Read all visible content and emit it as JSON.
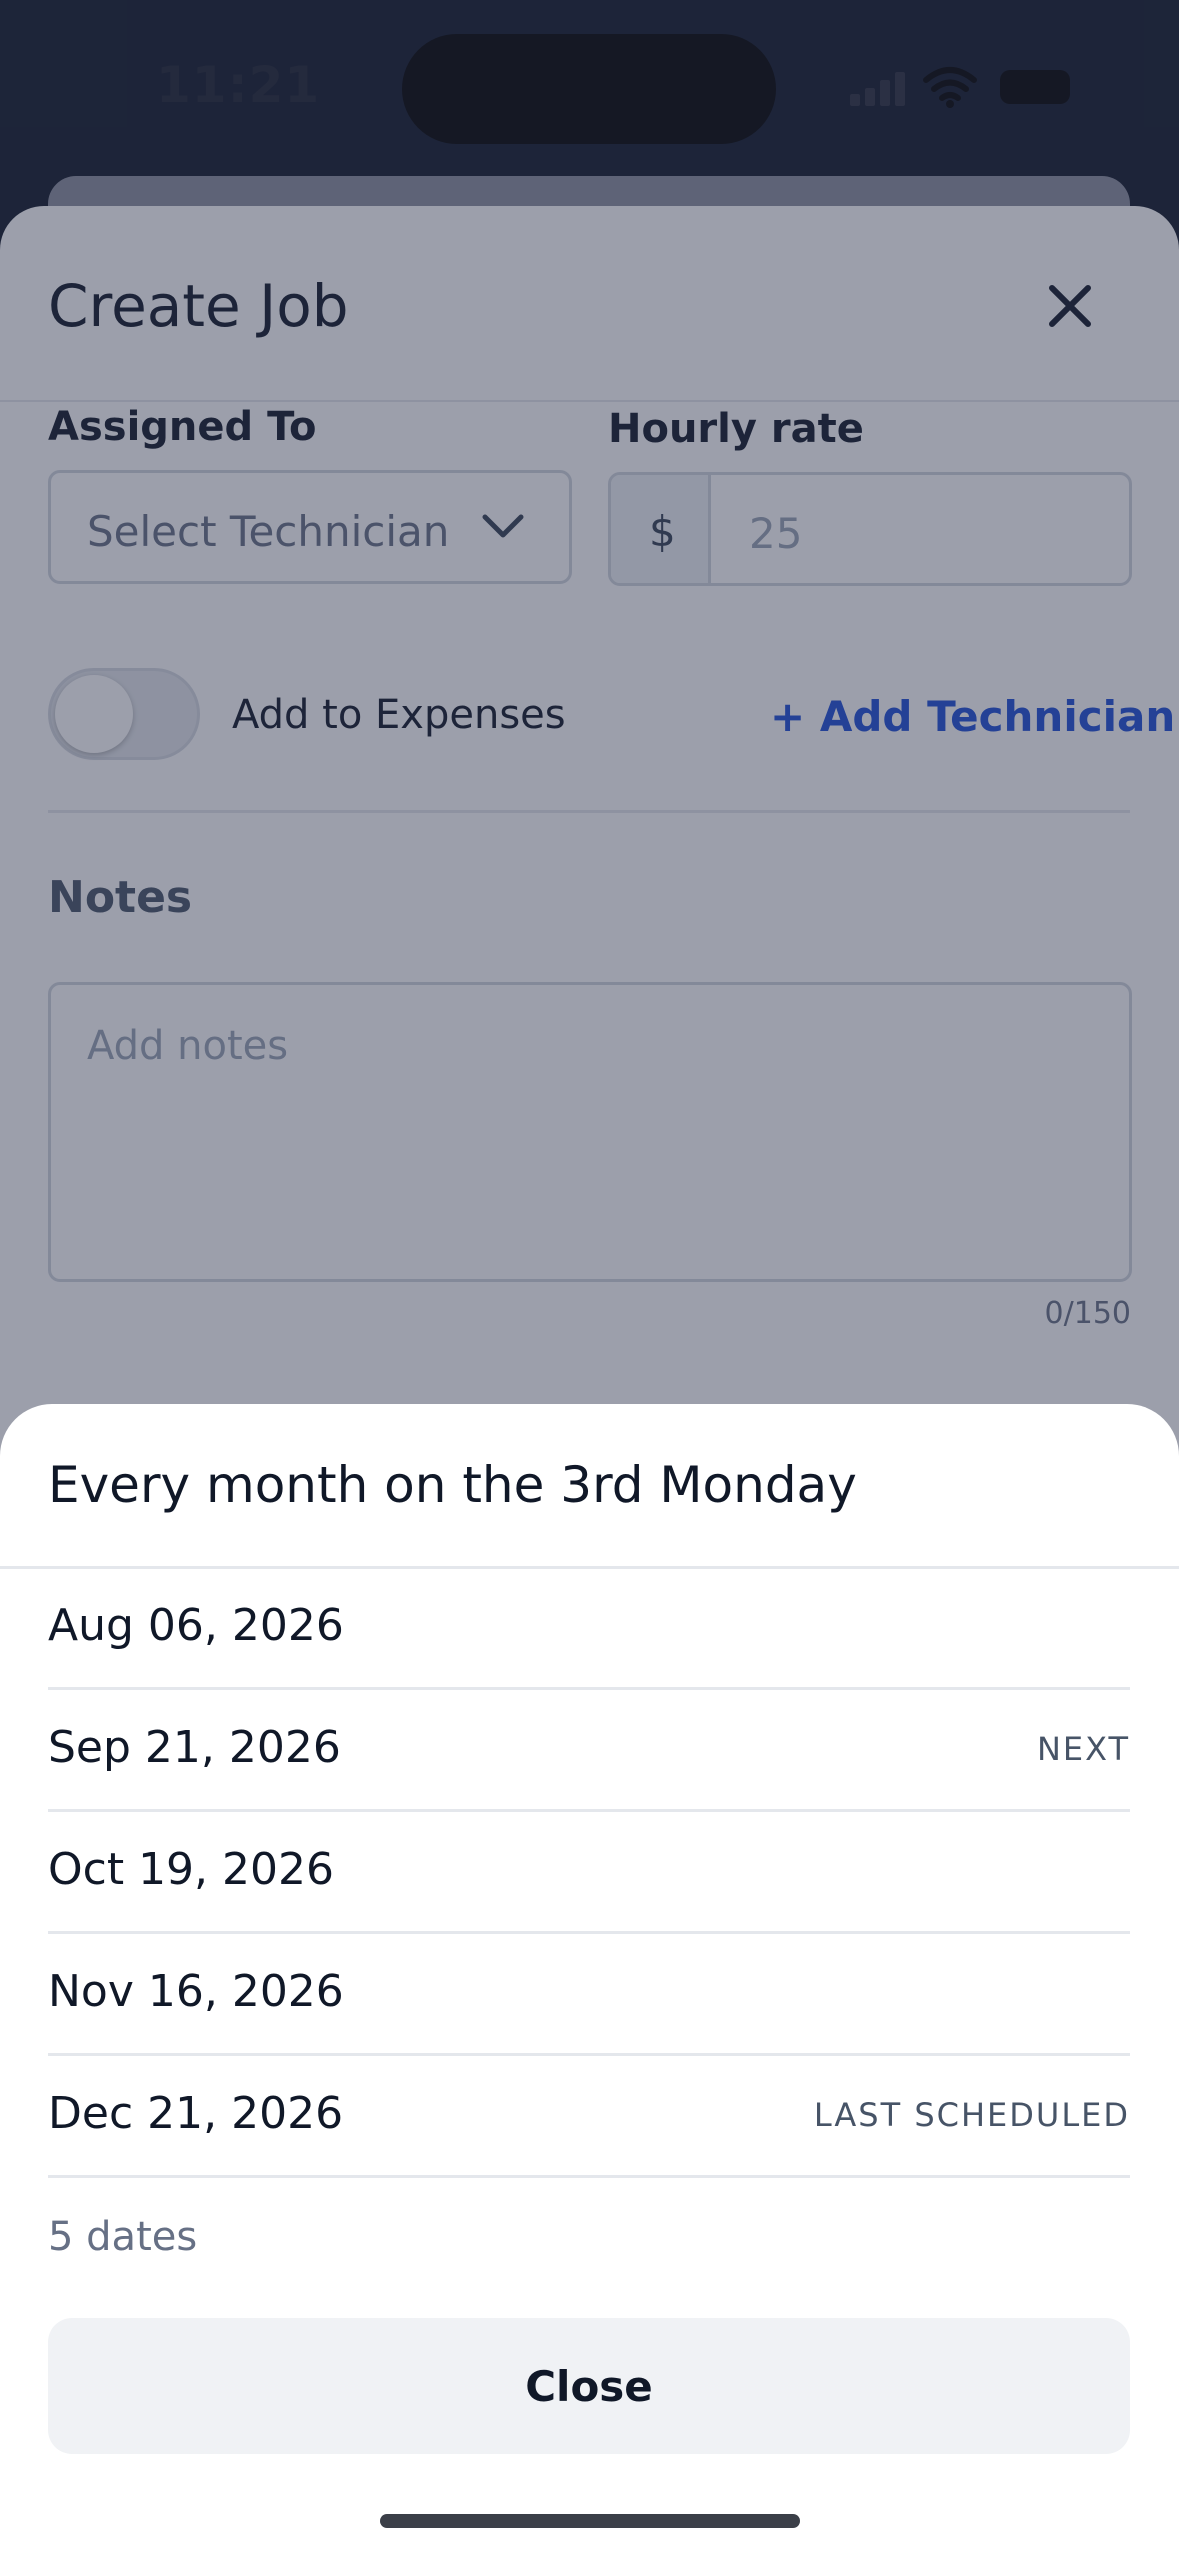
{
  "status_bar": {
    "time": "11:21"
  },
  "sheet": {
    "title": "Create Job",
    "assigned_to_label": "Assigned To",
    "technician_placeholder": "Select Technician",
    "hourly_rate_label": "Hourly rate",
    "currency_symbol": "$",
    "hourly_rate_value": "25",
    "expenses_toggle_label": "Add to Expenses",
    "expenses_toggle_on": false,
    "add_technician_label": "+ Add Technician",
    "notes_title": "Notes",
    "notes_placeholder": "Add notes",
    "notes_counter": "0/150"
  },
  "recurrence_sheet": {
    "title": "Every month on the 3rd Monday",
    "dates": [
      {
        "date": "Aug 06, 2026",
        "tag": ""
      },
      {
        "date": "Sep 21, 2026",
        "tag": "NEXT"
      },
      {
        "date": "Oct 19, 2026",
        "tag": ""
      },
      {
        "date": "Nov 16, 2026",
        "tag": ""
      },
      {
        "date": "Dec 21, 2026",
        "tag": "LAST SCHEDULED"
      }
    ],
    "count_label": "5 dates",
    "close_label": "Close"
  },
  "icons": {
    "close": "close-icon",
    "chevron": "chevron-down-icon",
    "signal": "cellular-signal-icon",
    "wifi": "wifi-icon",
    "battery": "battery-icon"
  },
  "colors": {
    "accent": "#1d4ed8",
    "overlay": "#2c344c",
    "text_primary": "#101828"
  }
}
